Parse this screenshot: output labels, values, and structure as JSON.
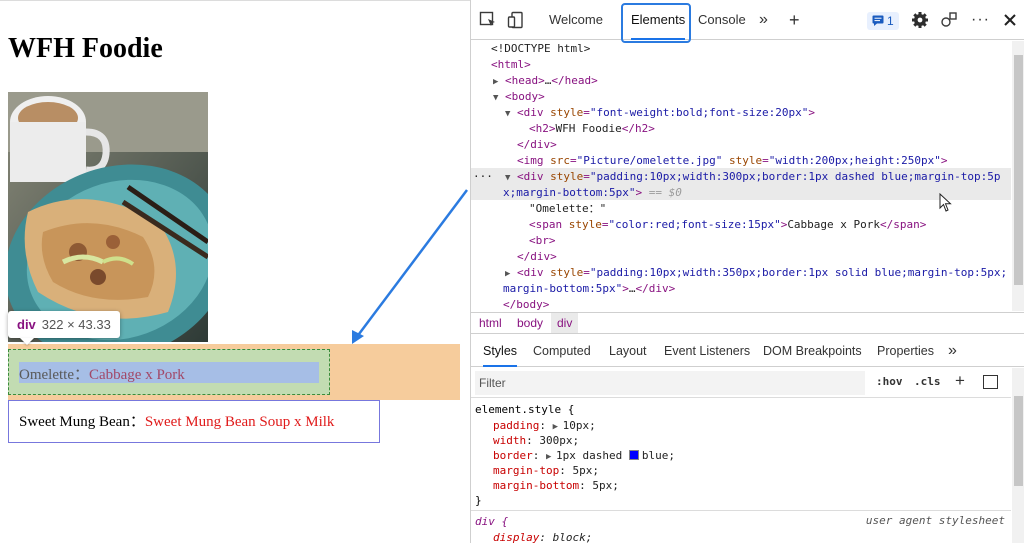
{
  "page": {
    "title": "WFH Foodie",
    "tooltip": {
      "tag": "div",
      "size": "322 × 43.33"
    },
    "box1": {
      "label": "Omelette：",
      "span": "Cabbage x Pork"
    },
    "box2": {
      "label": "Sweet Mung Bean：",
      "span": "Sweet Mung Bean Soup x Milk"
    }
  },
  "devtools": {
    "tabs": [
      "Welcome",
      "Elements",
      "Console"
    ],
    "more_tabs": "»",
    "add_tab": "+",
    "issues_count": "1",
    "dom": {
      "l1": "<!DOCTYPE html>",
      "l2": "<html>",
      "l3_open": "<head>",
      "l3_ell": "…",
      "l3_close": "</head>",
      "l4": "<body>",
      "l5_tag": "<div ",
      "l5_attr": "style",
      "l5_val": "\"font-weight:bold;font-size:20px\"",
      "l5_end": ">",
      "l6_open": "<h2>",
      "l6_text": "WFH Foodie",
      "l6_close": "</h2>",
      "l7": "</div>",
      "l8_tag": "<img ",
      "l8_a1": "src",
      "l8_v1": "\"Picture/omelette.jpg\"",
      "l8_a2": " style",
      "l8_v2": "\"width:200px;height:250px\"",
      "l8_end": ">",
      "l9_tag": "<div ",
      "l9_attr": "style",
      "l9_val_a": "\"padding:10px;width:300px;border:1px dashed blue;margin-top:5p",
      "l9_val_b": "x;margin-bottom:5px\"",
      "l9_end": ">",
      "l9_marker": " == $0",
      "l10": "\"Omelette：\"",
      "l11_tag": "<span ",
      "l11_attr": "style",
      "l11_val": "\"color:red;font-size:15px\"",
      "l11_end": ">",
      "l11_text": "Cabbage x Pork",
      "l11_close": "</span>",
      "l12": "<br>",
      "l13": "</div>",
      "l14_tag": "<div ",
      "l14_attr": "style",
      "l14_val_a": "\"padding:10px;width:350px;border:1px solid blue;margin-top:5px;",
      "l14_val_b": "margin-bottom:5px\"",
      "l14_end": ">",
      "l14_ell": "…",
      "l14_close": "</div>",
      "l15": "</body>",
      "gutter": "···"
    },
    "breadcrumbs": [
      "html",
      "body",
      "div"
    ],
    "style_tabs": [
      "Styles",
      "Computed",
      "Layout",
      "Event Listeners",
      "DOM Breakpoints",
      "Properties"
    ],
    "style_tabs_more": "»",
    "filter_placeholder": "Filter",
    "hov": ":hov",
    "cls": ".cls",
    "plus": "+",
    "styles": {
      "selector": "element.style {",
      "props": [
        {
          "name": "padding",
          "value": "10px;",
          "expand": true
        },
        {
          "name": "width",
          "value": "300px;",
          "expand": false
        },
        {
          "name": "border",
          "value": "1px dashed ",
          "color": "blue",
          "end": ";",
          "expand": true
        },
        {
          "name": "margin-top",
          "value": "5px;",
          "expand": false
        },
        {
          "name": "margin-bottom",
          "value": "5px;",
          "expand": false
        }
      ],
      "close": "}",
      "rule2_selector": "div {",
      "rule2_source": "user agent stylesheet",
      "rule2_prop": {
        "name": "display",
        "value": "block;"
      }
    }
  },
  "colors": {
    "accent": "#1a73e8",
    "swatch_blue": "#0000ff",
    "annotation": "#2b7be0"
  }
}
